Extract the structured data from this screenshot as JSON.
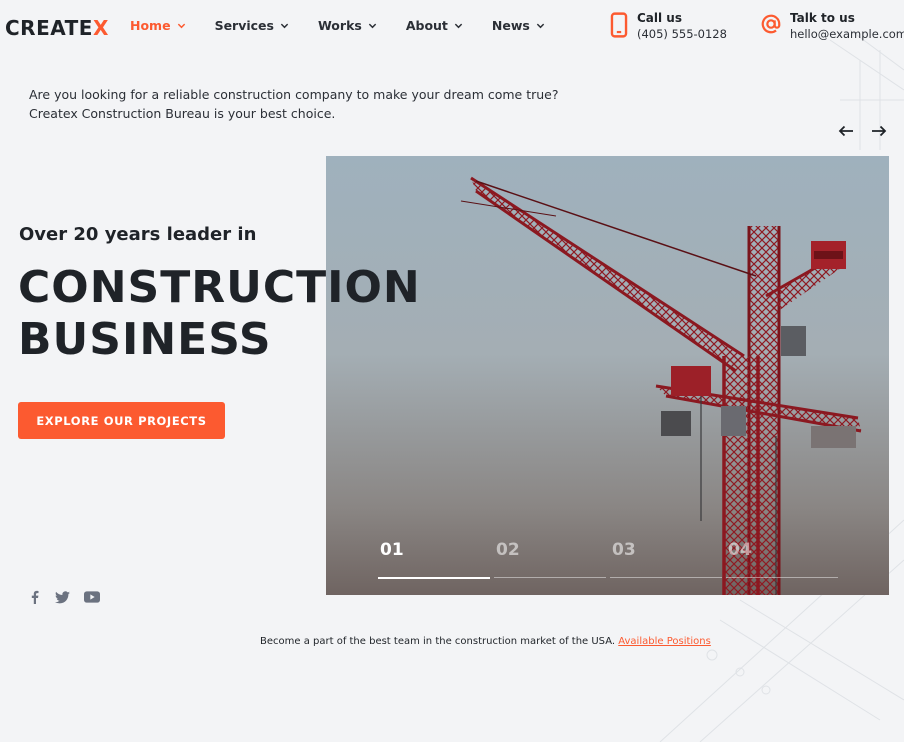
{
  "brand": {
    "logo_text": "CREATE",
    "logo_accent": "X",
    "accent_color": "#fc5a30"
  },
  "nav": {
    "items": [
      {
        "label": "Home",
        "active": true,
        "icon": "chevron-down-icon"
      },
      {
        "label": "Services",
        "active": false,
        "icon": "chevron-down-icon"
      },
      {
        "label": "Works",
        "active": false,
        "icon": "chevron-down-icon"
      },
      {
        "label": "About",
        "active": false,
        "icon": "chevron-down-icon"
      },
      {
        "label": "News",
        "active": false,
        "icon": "chevron-down-icon"
      }
    ]
  },
  "contact": {
    "phone": {
      "label": "Call us",
      "value": "(405) 555-0128",
      "icon": "phone-icon"
    },
    "email": {
      "label": "Talk to us",
      "value": "hello@example.com",
      "icon": "at-icon"
    }
  },
  "intro": {
    "line1": "Are you looking for a reliable construction company to make your dream come true?",
    "line2": "Createx Construction Bureau is your best choice."
  },
  "hero": {
    "subtitle": "Over 20 years leader in",
    "title_line1": "CONSTRUCTION",
    "title_line2": "BUSINESS",
    "cta_label": "EXPLORE OUR PROJECTS",
    "image_icon": "crane-photo"
  },
  "slider": {
    "prev_icon": "arrow-left-icon",
    "next_icon": "arrow-right-icon",
    "slides": [
      {
        "num": "01",
        "active": true
      },
      {
        "num": "02",
        "active": false
      },
      {
        "num": "03",
        "active": false
      },
      {
        "num": "04",
        "active": false
      }
    ]
  },
  "social": [
    "facebook-icon",
    "twitter-icon",
    "youtube-icon"
  ],
  "footer": {
    "text": "Become a part of the best team in the construction market of the USA.",
    "link": "Available Positions"
  }
}
